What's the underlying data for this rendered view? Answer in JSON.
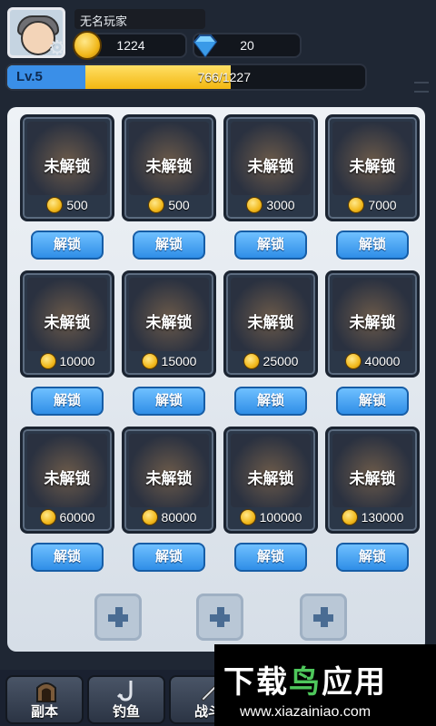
{
  "player": {
    "name": "无名玩家"
  },
  "currency": {
    "coins": "1224",
    "gems": "20"
  },
  "level": {
    "label": "Lv.5",
    "xp": "766/1227",
    "progress": 0.624
  },
  "cards": [
    {
      "status": "未解锁",
      "price": "500",
      "button": "解锁"
    },
    {
      "status": "未解锁",
      "price": "500",
      "button": "解锁"
    },
    {
      "status": "未解锁",
      "price": "3000",
      "button": "解锁"
    },
    {
      "status": "未解锁",
      "price": "7000",
      "button": "解锁"
    },
    {
      "status": "未解锁",
      "price": "10000",
      "button": "解锁"
    },
    {
      "status": "未解锁",
      "price": "15000",
      "button": "解锁"
    },
    {
      "status": "未解锁",
      "price": "25000",
      "button": "解锁"
    },
    {
      "status": "未解锁",
      "price": "40000",
      "button": "解锁"
    },
    {
      "status": "未解锁",
      "price": "60000",
      "button": "解锁"
    },
    {
      "status": "未解锁",
      "price": "80000",
      "button": "解锁"
    },
    {
      "status": "未解锁",
      "price": "100000",
      "button": "解锁"
    },
    {
      "status": "未解锁",
      "price": "130000",
      "button": "解锁"
    }
  ],
  "nav": [
    {
      "label": "副本",
      "icon": "gate-icon"
    },
    {
      "label": "钓鱼",
      "icon": "fishing-hook-icon"
    },
    {
      "label": "战斗",
      "icon": "sword-icon"
    }
  ],
  "watermark": {
    "title_left": "下载",
    "title_accent": "鸟",
    "title_right": "应用",
    "url": "www.xiazainiao.com"
  },
  "colors": {
    "unlock_button": "#2f8ee7",
    "level_fill": "#f3b711",
    "board": "#e6ecf2"
  }
}
